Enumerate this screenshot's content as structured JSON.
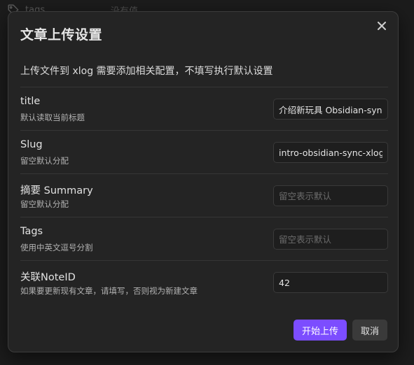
{
  "background": {
    "property_label": "tags",
    "property_value": "没有值",
    "icon": "tag-icon"
  },
  "modal": {
    "title": "文章上传设置",
    "close_icon": "close-icon",
    "description": "上传文件到 xlog 需要添加相关配置，不填写执行默认设置",
    "settings": [
      {
        "name": "title",
        "desc": "默认读取当前标题",
        "value": "介绍新玩具 Obsidian-sync",
        "placeholder": ""
      },
      {
        "name": "Slug",
        "desc": "留空默认分配",
        "value": "intro-obsidian-sync-xlog",
        "placeholder": ""
      },
      {
        "name": "摘要 Summary",
        "desc": "留空默认分配",
        "value": "",
        "placeholder": "留空表示默认"
      },
      {
        "name": "Tags",
        "desc": "使用中英文逗号分割",
        "value": "",
        "placeholder": "留空表示默认"
      },
      {
        "name": "关联NoteID",
        "desc": "如果要更新现有文章，请填写，否则视为新建文章",
        "value": "42",
        "placeholder": ""
      }
    ],
    "primary_button": "开始上传",
    "cancel_button": "取消"
  },
  "colors": {
    "accent": "#7c4dff",
    "background": "#1c1c1c",
    "modal_bg": "#242424"
  }
}
